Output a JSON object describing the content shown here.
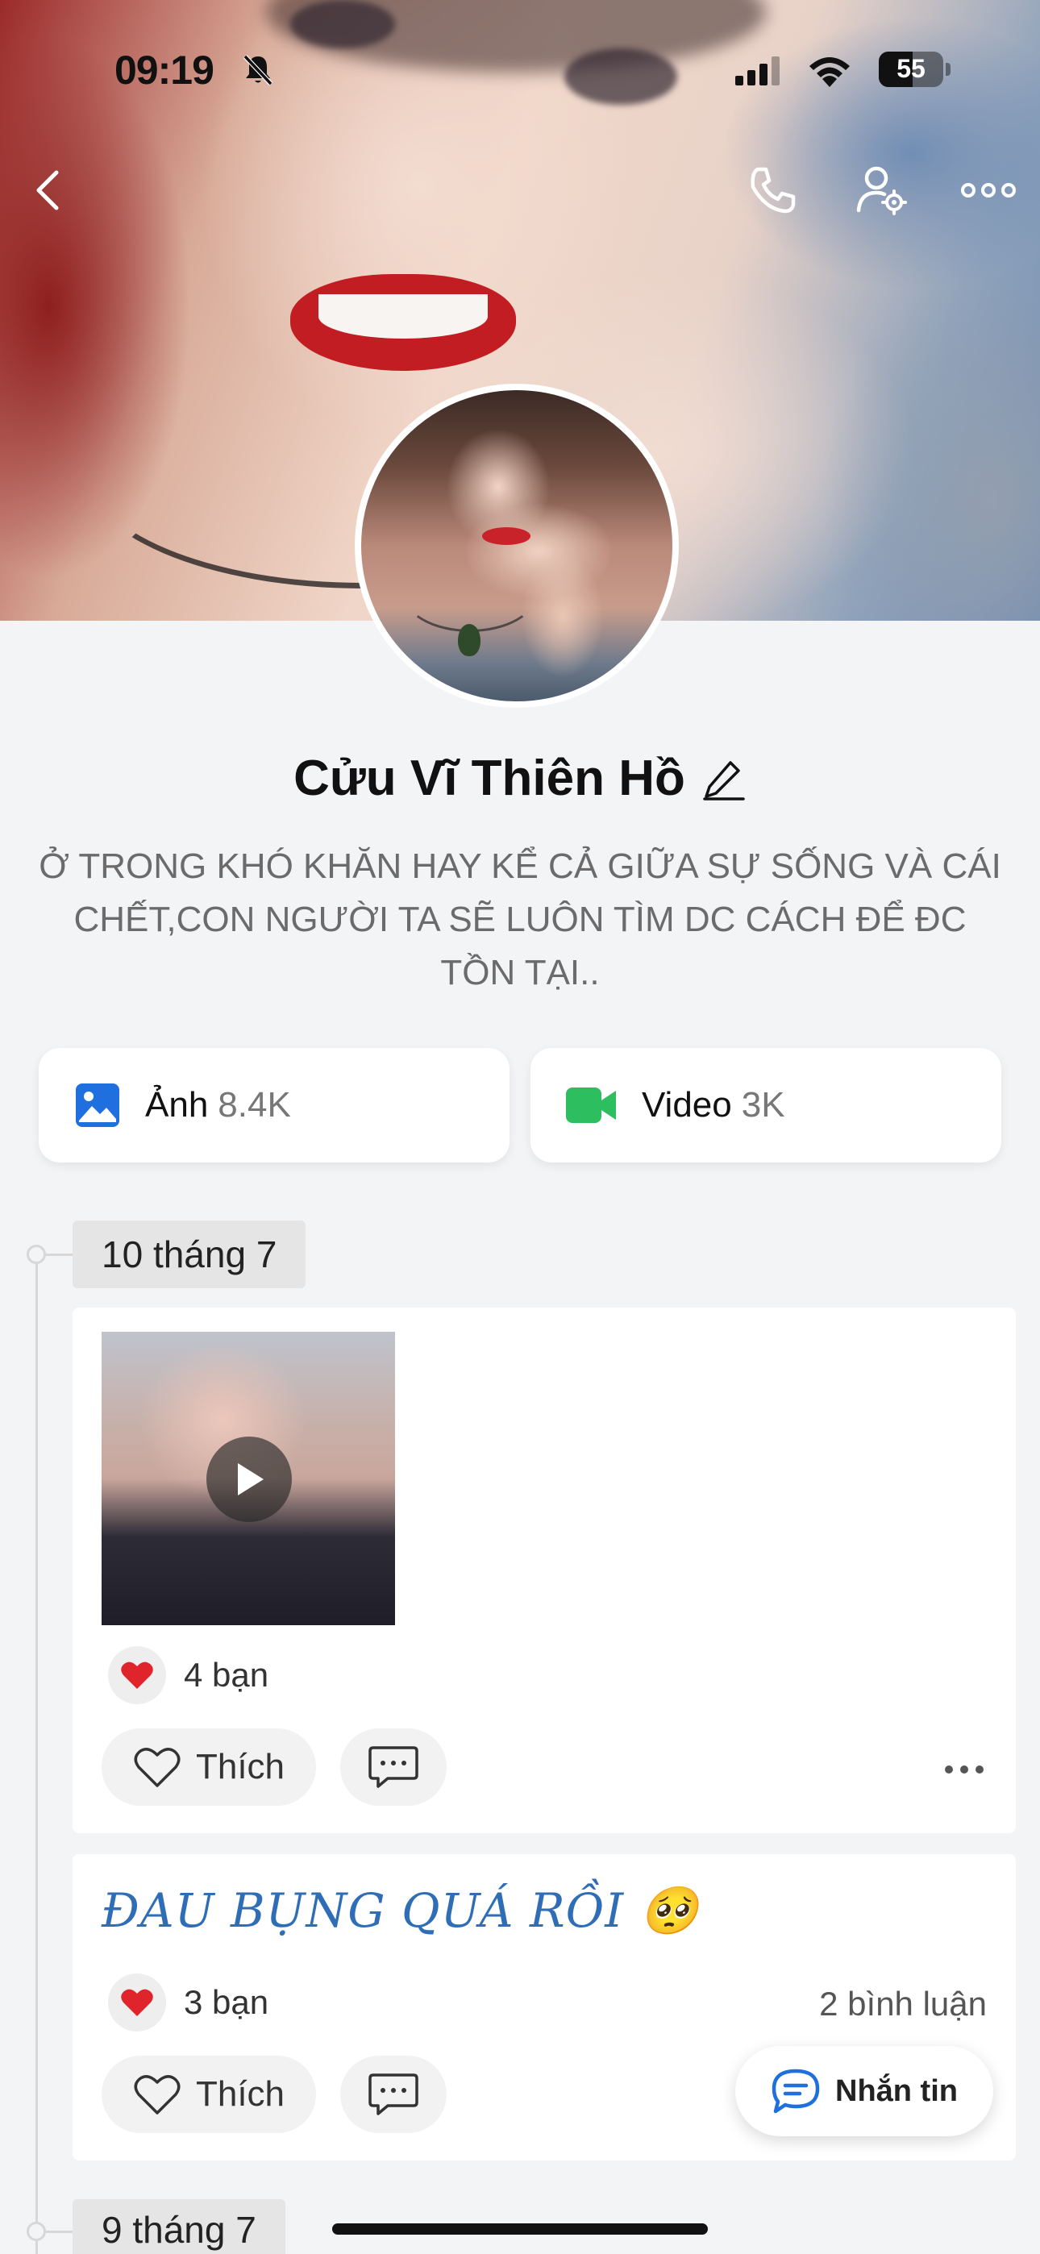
{
  "status_bar": {
    "time": "09:19",
    "battery_level": "55"
  },
  "profile": {
    "name": "Cửu Vĩ Thiên Hồ",
    "bio": "Ở TRONG KHÓ KHĂN HAY KỂ CẢ GIỮA SỰ SỐNG VÀ CÁI CHẾT,CON NGƯỜI TA SẼ LUÔN TÌM DC CÁCH ĐỂ ĐC TỒN TẠI.."
  },
  "media": {
    "photos_label": "Ảnh",
    "photos_count": "8.4K",
    "videos_label": "Video",
    "videos_count": "3K"
  },
  "timeline": {
    "groups": [
      {
        "date": "10 tháng 7"
      },
      {
        "date": "9 tháng 7"
      }
    ],
    "posts": [
      {
        "reactions": "4 bạn",
        "like_label": "Thích"
      },
      {
        "text": "ĐAU BỤNG QUÁ RỒI 🥺",
        "reactions": "3 bạn",
        "comments": "2 bình luận",
        "like_label": "Thích"
      }
    ]
  },
  "message_button": {
    "label": "Nhắn tin"
  },
  "colors": {
    "accent_blue": "#1f6fde",
    "video_green": "#2dbe60",
    "heart_red": "#e0242c"
  },
  "icons": [
    "back-icon",
    "phone-icon",
    "user-settings-icon",
    "more-icon",
    "bell-off-icon",
    "signal-icon",
    "wifi-icon",
    "edit-icon",
    "image-icon",
    "video-camera-icon",
    "heart-icon",
    "comment-icon",
    "play-icon",
    "chat-icon"
  ]
}
